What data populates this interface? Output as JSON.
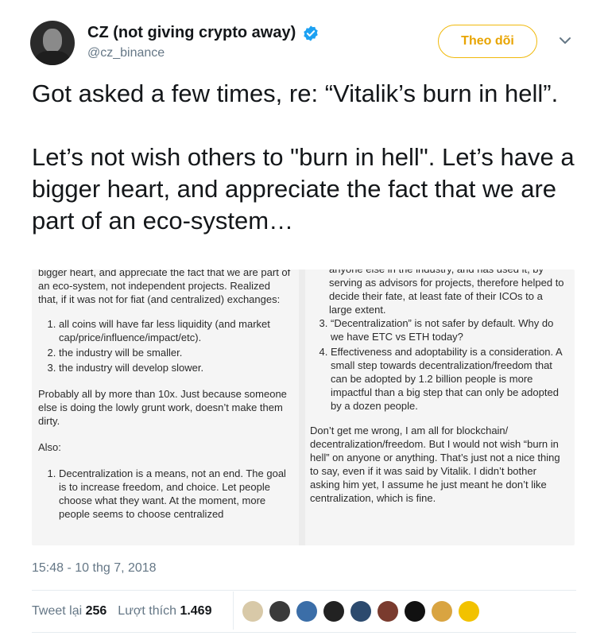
{
  "user": {
    "display_name": "CZ (not giving crypto away)",
    "handle": "@cz_binance",
    "avatar_icon": "user-photo-avatar",
    "verified_icon": "verified-badge-icon"
  },
  "follow_button": {
    "label": "Theo dõi",
    "color": "#f0b90b"
  },
  "menu_icon": "chevron-down-icon",
  "tweet": {
    "text": "Got asked a few times, re: “Vitalik’s burn in hell”.\n\nLet’s not wish others to \"burn in hell\".  Let’s have a bigger heart, and appreciate the fact that we are part of an eco-system…"
  },
  "media": {
    "left": {
      "intro": "bigger heart, and appreciate the fact that we are part of an eco-system, not independent projects. Realized that, if it was not for fiat (and centralized) exchanges:",
      "list1": [
        "all coins will have far less liquidity (and market cap/price/influence/impact/etc).",
        "the industry will be smaller.",
        "the industry will develop slower."
      ],
      "para2": "Probably all by more than 10x.  Just because someone else is doing the lowly grunt work, doesn’t make them dirty.",
      "also": "Also:",
      "list2": [
        "Decentralization is a means, not an end.  The goal is to increase freedom, and choice.  Let people choose what they want.  At the moment, more people seems to choose centralized"
      ]
    },
    "right": {
      "top_cut": "anyone else in the industry, and has used it, by",
      "top": "serving as advisors for projects, therefore helped to decide their fate, at least fate of their ICOs to a large extent.",
      "list": [
        "“Decentralization” is not safer by default.  Why do we have ETC vs ETH today?",
        "Effectiveness and adoptability is a consideration. A small step towards decentralization/freedom that can be adopted by 1.2 billion people is more impactful than a big step that can only be adopted by a dozen people."
      ],
      "closing": "Don’t get me wrong, I am all for blockchain/ decentralization/freedom.  But I would not wish “burn in hell” on anyone or anything.  That’s just not a nice thing to say, even if it was said by Vitalik.  I didn’t bother asking him yet, I assume he just meant he don’t like centralization, which is fine."
    }
  },
  "timestamp": "15:48 - 10 thg 7, 2018",
  "stats": {
    "retweets_label": "Tweet lại",
    "retweets": "256",
    "likes_label": "Lượt thích",
    "likes": "1.469"
  },
  "liker_avatars": [
    {
      "icon": "liker-avatar-icon",
      "color": "#d8c9a8"
    },
    {
      "icon": "liker-avatar-icon",
      "color": "#3a3a3a"
    },
    {
      "icon": "liker-avatar-icon",
      "color": "#3b6ea8"
    },
    {
      "icon": "liker-avatar-icon",
      "color": "#222222"
    },
    {
      "icon": "liker-avatar-icon",
      "color": "#2c4a6e"
    },
    {
      "icon": "liker-avatar-icon",
      "color": "#7a3b2e"
    },
    {
      "icon": "liker-avatar-icon",
      "color": "#111111"
    },
    {
      "icon": "liker-avatar-icon",
      "color": "#d9a441"
    },
    {
      "icon": "liker-avatar-icon",
      "color": "#f2c200"
    }
  ]
}
